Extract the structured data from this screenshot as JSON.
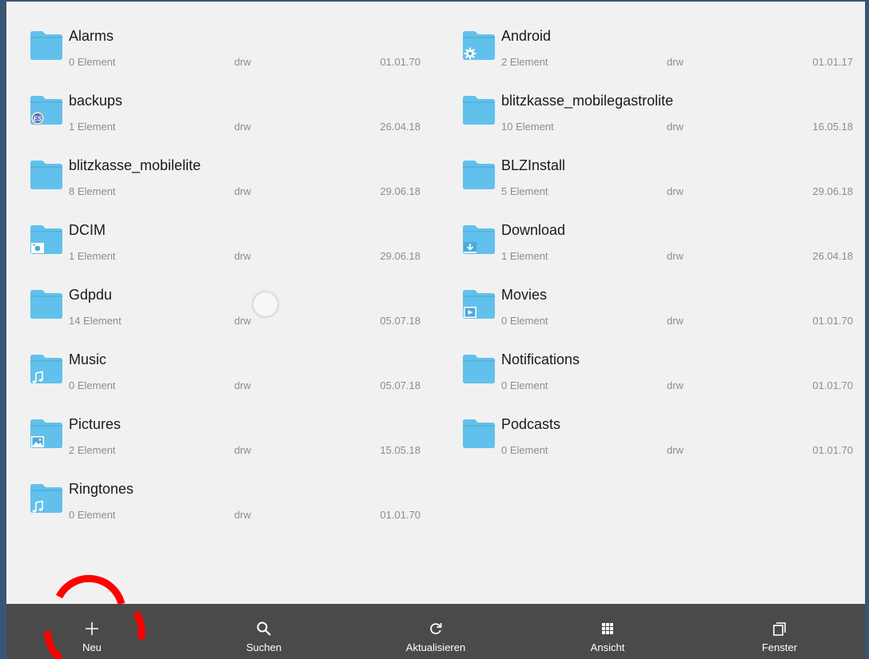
{
  "colors": {
    "folder": "#62c1ec",
    "folder_tab": "#56b2de",
    "background": "#f1f1f1",
    "toolbar": "#4a4a4a",
    "frame": "#3a5574",
    "annotation": "#ff0000"
  },
  "folders": [
    {
      "name": "Alarms",
      "count": "0 Element",
      "perm": "drw",
      "date": "01.01.70",
      "badge": null
    },
    {
      "name": "Android",
      "count": "2 Element",
      "perm": "drw",
      "date": "01.01.17",
      "badge": "gear-icon"
    },
    {
      "name": "backups",
      "count": "1 Element",
      "perm": "drw",
      "date": "26.04.18",
      "badge": "es-app-icon"
    },
    {
      "name": "blitzkasse_mobilegastrolite",
      "count": "10 Element",
      "perm": "drw",
      "date": "16.05.18",
      "badge": null
    },
    {
      "name": "blitzkasse_mobilelite",
      "count": "8 Element",
      "perm": "drw",
      "date": "29.06.18",
      "badge": null
    },
    {
      "name": "BLZInstall",
      "count": "5 Element",
      "perm": "drw",
      "date": "29.06.18",
      "badge": null
    },
    {
      "name": "DCIM",
      "count": "1 Element",
      "perm": "drw",
      "date": "29.06.18",
      "badge": "camera-icon"
    },
    {
      "name": "Download",
      "count": "1 Element",
      "perm": "drw",
      "date": "26.04.18",
      "badge": "download-arrow-icon"
    },
    {
      "name": "Gdpdu",
      "count": "14 Element",
      "perm": "drw",
      "date": "05.07.18",
      "badge": null
    },
    {
      "name": "Movies",
      "count": "0 Element",
      "perm": "drw",
      "date": "01.01.70",
      "badge": "video-icon"
    },
    {
      "name": "Music",
      "count": "0 Element",
      "perm": "drw",
      "date": "05.07.18",
      "badge": "music-note-icon"
    },
    {
      "name": "Notifications",
      "count": "0 Element",
      "perm": "drw",
      "date": "01.01.70",
      "badge": null
    },
    {
      "name": "Pictures",
      "count": "2 Element",
      "perm": "drw",
      "date": "15.05.18",
      "badge": "image-icon"
    },
    {
      "name": "Podcasts",
      "count": "0 Element",
      "perm": "drw",
      "date": "01.01.70",
      "badge": null
    },
    {
      "name": "Ringtones",
      "count": "0 Element",
      "perm": "drw",
      "date": "01.01.70",
      "badge": "music-note-icon"
    }
  ],
  "toolbar": {
    "new_label": "Neu",
    "search_label": "Suchen",
    "refresh_label": "Aktualisieren",
    "view_label": "Ansicht",
    "window_label": "Fenster"
  }
}
